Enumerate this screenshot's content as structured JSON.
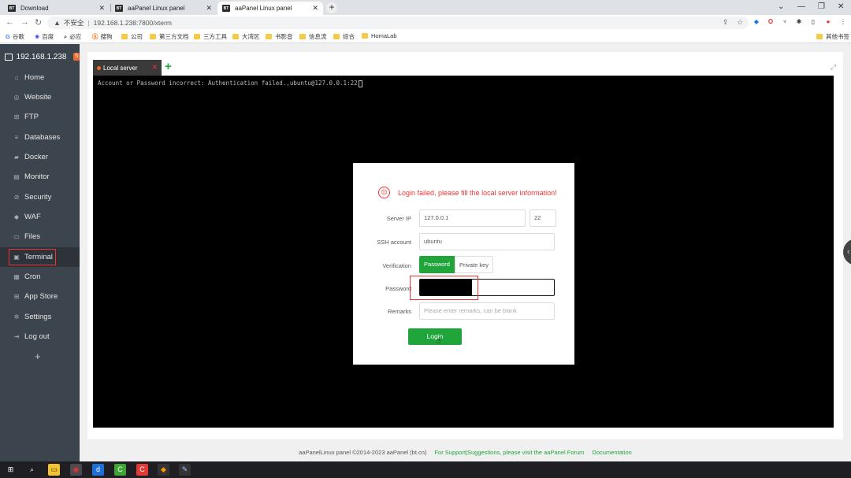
{
  "browser": {
    "tabs": [
      {
        "label": "Download",
        "favicon": "BT"
      },
      {
        "label": "aaPanel Linux panel",
        "favicon": "BT"
      },
      {
        "label": "aaPanel Linux panel",
        "favicon": "BT",
        "active": true
      }
    ],
    "address": {
      "warning": "不安全",
      "url": "192.168.1.238:7800/xterm"
    },
    "bookmarks": [
      "谷歌",
      "百度",
      "必应",
      "搜狗",
      "公司",
      "第三方文档",
      "三方工具",
      "大湾区",
      "书影音",
      "信息流",
      "综合",
      "HomaLab"
    ],
    "bookmarks_right": "其他书签"
  },
  "sidebar": {
    "server": "192.168.1.238",
    "badge": "5",
    "items": [
      {
        "label": "Home",
        "icon": "home-icon"
      },
      {
        "label": "Website",
        "icon": "globe-icon"
      },
      {
        "label": "FTP",
        "icon": "ftp-icon"
      },
      {
        "label": "Databases",
        "icon": "database-icon"
      },
      {
        "label": "Docker",
        "icon": "docker-icon"
      },
      {
        "label": "Monitor",
        "icon": "monitor-icon"
      },
      {
        "label": "Security",
        "icon": "shield-check-icon"
      },
      {
        "label": "WAF",
        "icon": "waf-shield-icon"
      },
      {
        "label": "Files",
        "icon": "folder-icon"
      },
      {
        "label": "Terminal",
        "icon": "terminal-icon",
        "active": true
      },
      {
        "label": "Cron",
        "icon": "calendar-icon"
      },
      {
        "label": "App Store",
        "icon": "grid-icon"
      },
      {
        "label": "Settings",
        "icon": "gear-icon"
      },
      {
        "label": "Log out",
        "icon": "logout-icon"
      }
    ],
    "add": "+"
  },
  "terminal": {
    "tab_label": "Local server",
    "output": "Account or Password incorrect: Authentication failed.,ubuntu@127.0.0.1:22"
  },
  "modal": {
    "error": "Login failed, please fill the local server information!",
    "server_ip_label": "Server IP",
    "server_ip": "127.0.0.1",
    "port": "22",
    "ssh_label": "SSH account",
    "ssh_account": "ubuntu",
    "verification_label": "Verification",
    "verify_password": "Password",
    "verify_key": "Private key",
    "password_label": "Password",
    "remarks_label": "Remarks",
    "remarks_placeholder": "Please enter remarks, can be blank",
    "login": "Login"
  },
  "footer": {
    "copyright": "aaPanelLinux panel ©2014-2023 aaPanel (bt.cn)",
    "support": "For Support|Suggestions, please visit the aaPanel Forum",
    "docs": "Documentation"
  }
}
